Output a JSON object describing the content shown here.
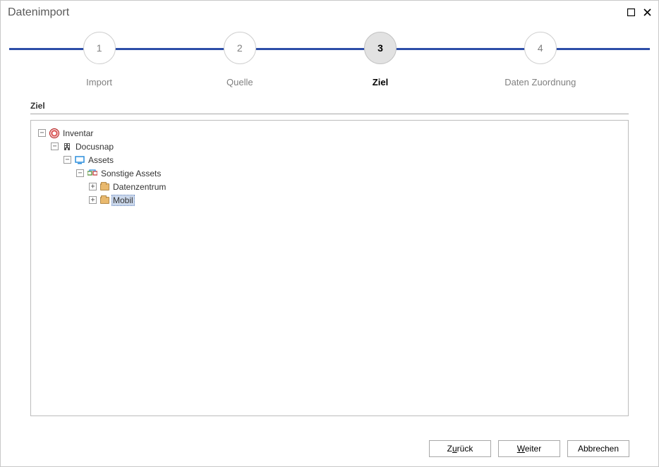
{
  "window": {
    "title": "Datenimport"
  },
  "wizard": {
    "steps": [
      {
        "num": "1",
        "label": "Import",
        "active": false
      },
      {
        "num": "2",
        "label": "Quelle",
        "active": false
      },
      {
        "num": "3",
        "label": "Ziel",
        "active": true
      },
      {
        "num": "4",
        "label": "Daten Zuordnung",
        "active": false
      }
    ]
  },
  "section": {
    "title": "Ziel"
  },
  "tree": {
    "inventar": "Inventar",
    "docusnap": "Docusnap",
    "assets": "Assets",
    "sonstige": "Sonstige Assets",
    "datenzentrum": "Datenzentrum",
    "mobil": "Mobil"
  },
  "buttons": {
    "back_pre": "Z",
    "back_u": "u",
    "back_post": "rück",
    "next_pre": "",
    "next_u": "W",
    "next_post": "eiter",
    "cancel": "Abbrechen"
  }
}
